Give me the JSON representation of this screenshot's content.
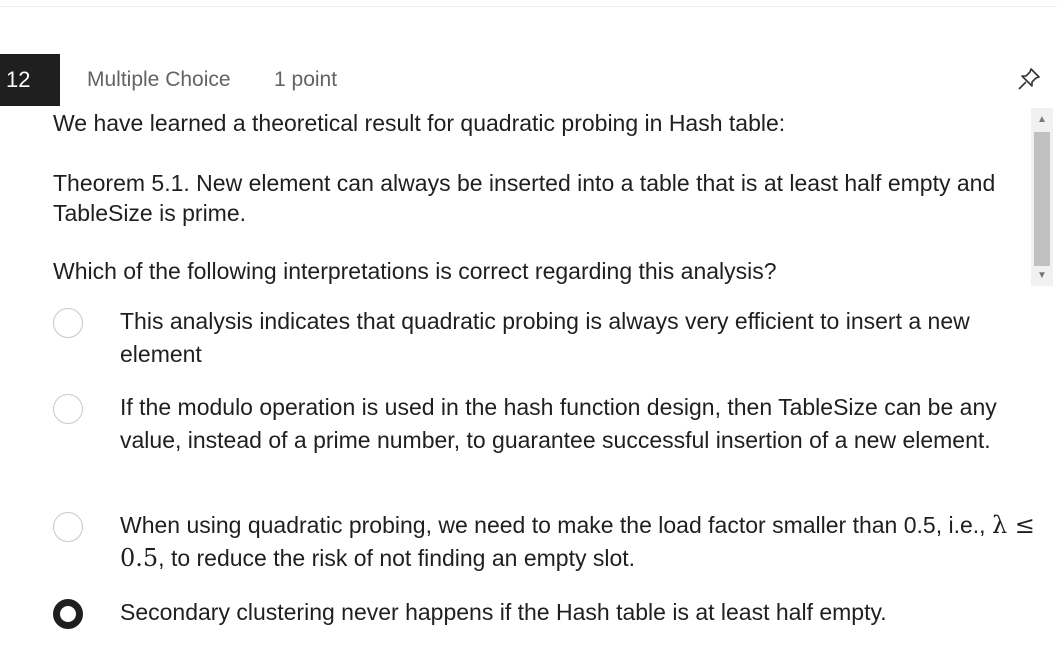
{
  "question": {
    "number": "12",
    "type": "Multiple Choice",
    "points": "1 point",
    "pin_icon": "pin-icon",
    "prompt": {
      "line1": "We have learned a theoretical result for quadratic probing in Hash table:",
      "theorem": "Theorem 5.1. New element can always be inserted into a table that is at least half empty and TableSize is prime.",
      "question": "Which of the following interpretations is correct regarding this analysis?"
    },
    "options": [
      {
        "text": "This analysis indicates that quadratic probing is always very efficient to insert a new element",
        "selected": false
      },
      {
        "text": "If the modulo operation is used in the hash function design, then TableSize can be any value, instead of a prime number, to guarantee successful insertion of a new element.",
        "selected": false
      },
      {
        "text_before": "When using quadratic probing, we need to make the load factor smaller than 0.5, i.e., ",
        "math": "λ ≤ 0.5",
        "text_after": ", to reduce the risk of not finding an empty slot.",
        "selected": false
      },
      {
        "text": "Secondary clustering never happens if the Hash table is at least half empty.",
        "selected": true
      }
    ]
  },
  "colors": {
    "number_badge_bg": "#1f1f1f",
    "meta_text": "#636363",
    "radio_border": "#c8c8c8",
    "radio_selected": "#1f1f1f"
  }
}
